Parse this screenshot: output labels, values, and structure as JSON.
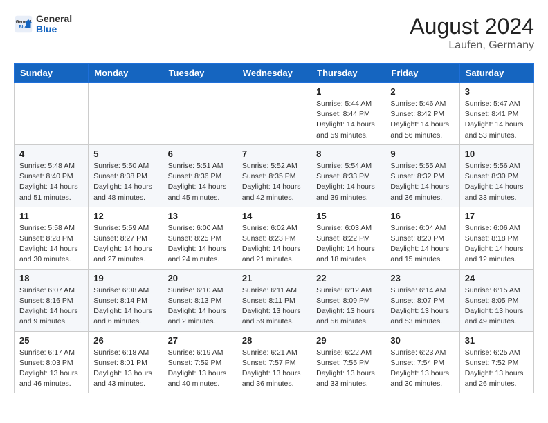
{
  "header": {
    "logo_general": "General",
    "logo_blue": "Blue",
    "title": "August 2024",
    "subtitle": "Laufen, Germany"
  },
  "days_of_week": [
    "Sunday",
    "Monday",
    "Tuesday",
    "Wednesday",
    "Thursday",
    "Friday",
    "Saturday"
  ],
  "weeks": [
    [
      {
        "day": "",
        "sunrise": "",
        "sunset": "",
        "daylight": ""
      },
      {
        "day": "",
        "sunrise": "",
        "sunset": "",
        "daylight": ""
      },
      {
        "day": "",
        "sunrise": "",
        "sunset": "",
        "daylight": ""
      },
      {
        "day": "",
        "sunrise": "",
        "sunset": "",
        "daylight": ""
      },
      {
        "day": "1",
        "sunrise": "5:44 AM",
        "sunset": "8:44 PM",
        "daylight": "14 hours and 59 minutes."
      },
      {
        "day": "2",
        "sunrise": "5:46 AM",
        "sunset": "8:42 PM",
        "daylight": "14 hours and 56 minutes."
      },
      {
        "day": "3",
        "sunrise": "5:47 AM",
        "sunset": "8:41 PM",
        "daylight": "14 hours and 53 minutes."
      }
    ],
    [
      {
        "day": "4",
        "sunrise": "5:48 AM",
        "sunset": "8:40 PM",
        "daylight": "14 hours and 51 minutes."
      },
      {
        "day": "5",
        "sunrise": "5:50 AM",
        "sunset": "8:38 PM",
        "daylight": "14 hours and 48 minutes."
      },
      {
        "day": "6",
        "sunrise": "5:51 AM",
        "sunset": "8:36 PM",
        "daylight": "14 hours and 45 minutes."
      },
      {
        "day": "7",
        "sunrise": "5:52 AM",
        "sunset": "8:35 PM",
        "daylight": "14 hours and 42 minutes."
      },
      {
        "day": "8",
        "sunrise": "5:54 AM",
        "sunset": "8:33 PM",
        "daylight": "14 hours and 39 minutes."
      },
      {
        "day": "9",
        "sunrise": "5:55 AM",
        "sunset": "8:32 PM",
        "daylight": "14 hours and 36 minutes."
      },
      {
        "day": "10",
        "sunrise": "5:56 AM",
        "sunset": "8:30 PM",
        "daylight": "14 hours and 33 minutes."
      }
    ],
    [
      {
        "day": "11",
        "sunrise": "5:58 AM",
        "sunset": "8:28 PM",
        "daylight": "14 hours and 30 minutes."
      },
      {
        "day": "12",
        "sunrise": "5:59 AM",
        "sunset": "8:27 PM",
        "daylight": "14 hours and 27 minutes."
      },
      {
        "day": "13",
        "sunrise": "6:00 AM",
        "sunset": "8:25 PM",
        "daylight": "14 hours and 24 minutes."
      },
      {
        "day": "14",
        "sunrise": "6:02 AM",
        "sunset": "8:23 PM",
        "daylight": "14 hours and 21 minutes."
      },
      {
        "day": "15",
        "sunrise": "6:03 AM",
        "sunset": "8:22 PM",
        "daylight": "14 hours and 18 minutes."
      },
      {
        "day": "16",
        "sunrise": "6:04 AM",
        "sunset": "8:20 PM",
        "daylight": "14 hours and 15 minutes."
      },
      {
        "day": "17",
        "sunrise": "6:06 AM",
        "sunset": "8:18 PM",
        "daylight": "14 hours and 12 minutes."
      }
    ],
    [
      {
        "day": "18",
        "sunrise": "6:07 AM",
        "sunset": "8:16 PM",
        "daylight": "14 hours and 9 minutes."
      },
      {
        "day": "19",
        "sunrise": "6:08 AM",
        "sunset": "8:14 PM",
        "daylight": "14 hours and 6 minutes."
      },
      {
        "day": "20",
        "sunrise": "6:10 AM",
        "sunset": "8:13 PM",
        "daylight": "14 hours and 2 minutes."
      },
      {
        "day": "21",
        "sunrise": "6:11 AM",
        "sunset": "8:11 PM",
        "daylight": "13 hours and 59 minutes."
      },
      {
        "day": "22",
        "sunrise": "6:12 AM",
        "sunset": "8:09 PM",
        "daylight": "13 hours and 56 minutes."
      },
      {
        "day": "23",
        "sunrise": "6:14 AM",
        "sunset": "8:07 PM",
        "daylight": "13 hours and 53 minutes."
      },
      {
        "day": "24",
        "sunrise": "6:15 AM",
        "sunset": "8:05 PM",
        "daylight": "13 hours and 49 minutes."
      }
    ],
    [
      {
        "day": "25",
        "sunrise": "6:17 AM",
        "sunset": "8:03 PM",
        "daylight": "13 hours and 46 minutes."
      },
      {
        "day": "26",
        "sunrise": "6:18 AM",
        "sunset": "8:01 PM",
        "daylight": "13 hours and 43 minutes."
      },
      {
        "day": "27",
        "sunrise": "6:19 AM",
        "sunset": "7:59 PM",
        "daylight": "13 hours and 40 minutes."
      },
      {
        "day": "28",
        "sunrise": "6:21 AM",
        "sunset": "7:57 PM",
        "daylight": "13 hours and 36 minutes."
      },
      {
        "day": "29",
        "sunrise": "6:22 AM",
        "sunset": "7:55 PM",
        "daylight": "13 hours and 33 minutes."
      },
      {
        "day": "30",
        "sunrise": "6:23 AM",
        "sunset": "7:54 PM",
        "daylight": "13 hours and 30 minutes."
      },
      {
        "day": "31",
        "sunrise": "6:25 AM",
        "sunset": "7:52 PM",
        "daylight": "13 hours and 26 minutes."
      }
    ]
  ]
}
